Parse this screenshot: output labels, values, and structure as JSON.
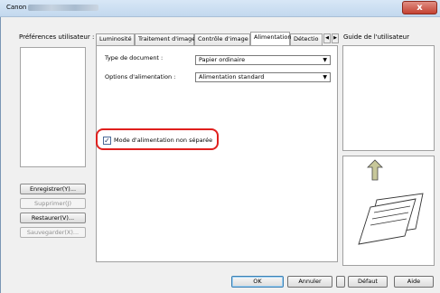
{
  "window": {
    "title_prefix": "Canon",
    "close_label": "x"
  },
  "left": {
    "label": "Préférences utilisateur :",
    "buttons": {
      "save": "Enregistrer(Y)...",
      "delete": "Supprimer(J)",
      "restore": "Restaurer(V)...",
      "backup": "Sauvegarder(X)..."
    }
  },
  "tabs": [
    "Luminosité",
    "Traitement d'image",
    "Contrôle d'image",
    "Alimentation",
    "Détectio"
  ],
  "tab_active_index": 3,
  "form": {
    "doc_type_label": "Type de document :",
    "doc_type_value": "Papier ordinaire",
    "feed_options_label": "Options d'alimentation :",
    "feed_options_value": "Alimentation standard",
    "checkbox_label": "Mode d'alimentation non séparée",
    "checkbox_checked": true
  },
  "right": {
    "guide_label": "Guide de l'utilisateur"
  },
  "bottom": {
    "ok": "OK",
    "cancel": "Annuler",
    "apply": "Appliquer",
    "default": "Défaut",
    "help": "Aide"
  }
}
